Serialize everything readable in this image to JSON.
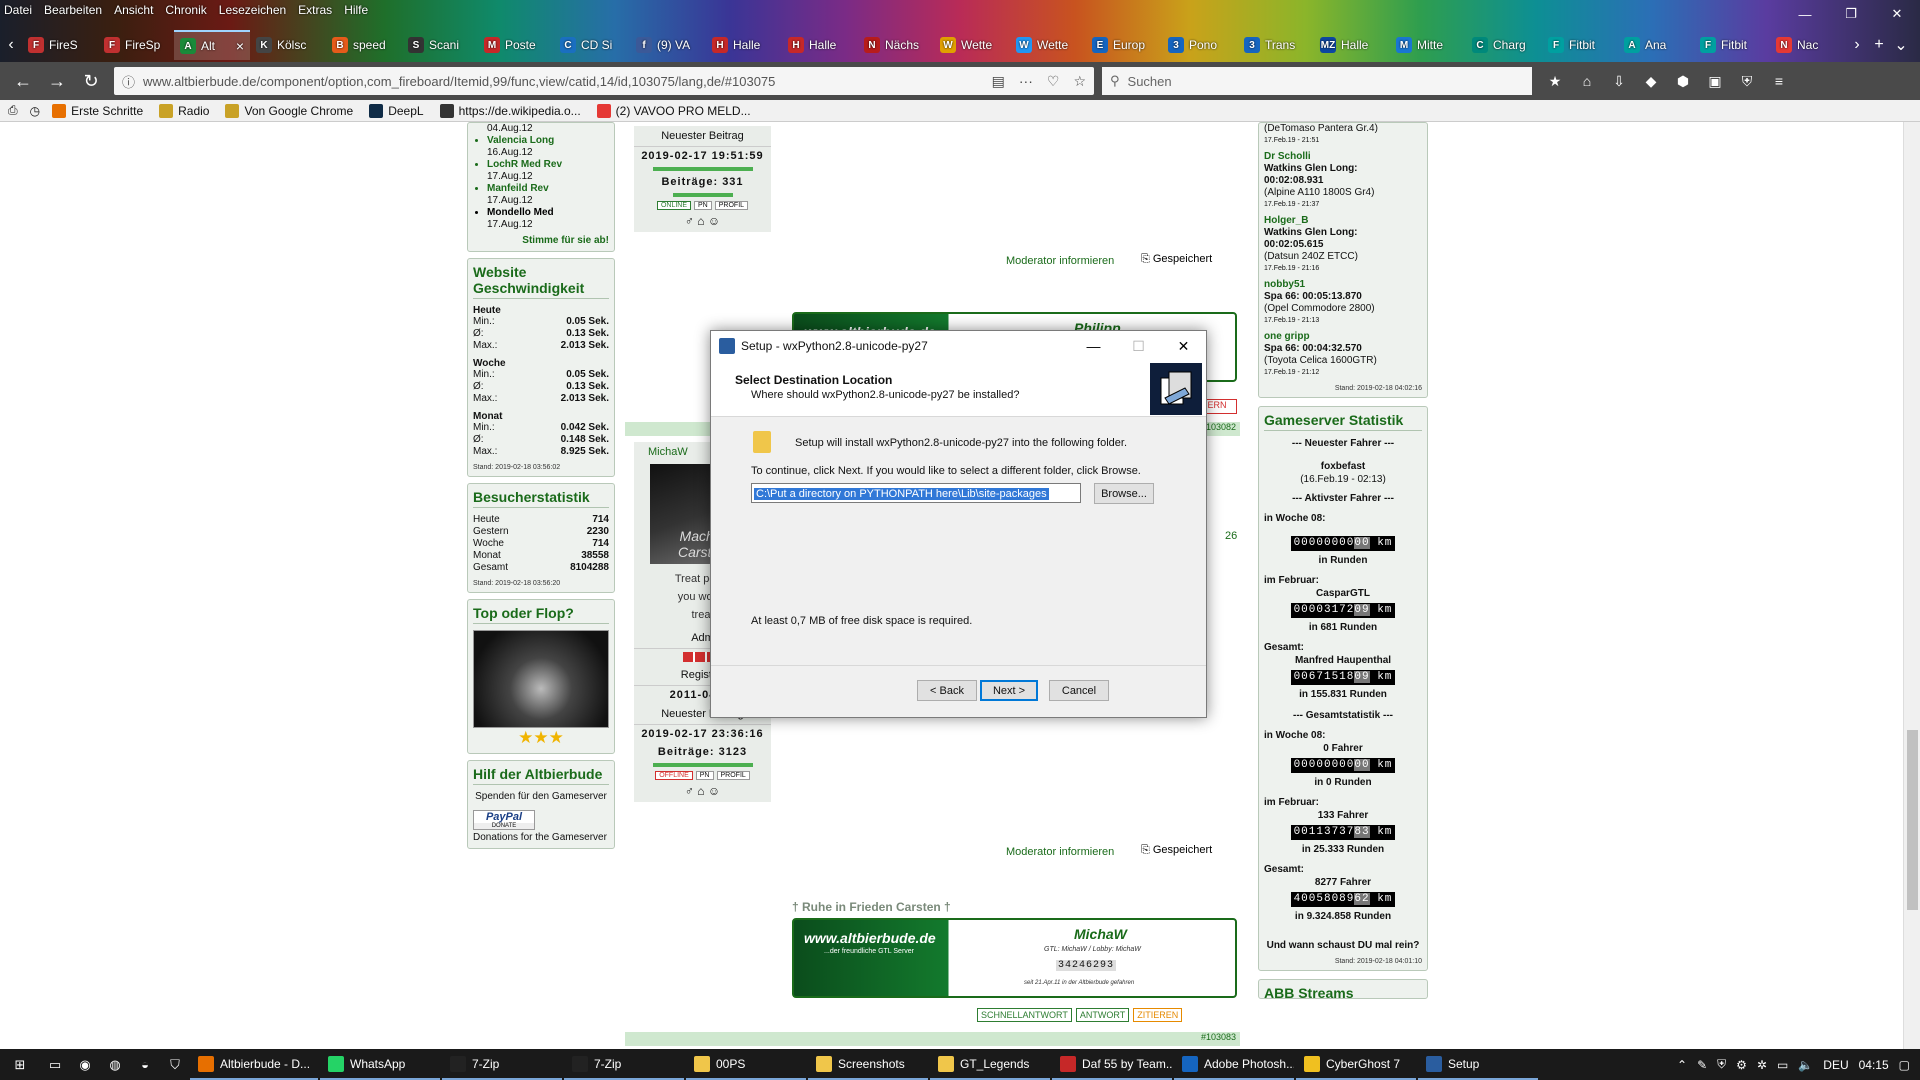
{
  "menu": [
    "Datei",
    "Bearbeiten",
    "Ansicht",
    "Chronik",
    "Lesezeichen",
    "Extras",
    "Hilfe"
  ],
  "tabs": [
    {
      "label": "FireS",
      "color": "#c03030",
      "glyph": "F"
    },
    {
      "label": "FireSp",
      "color": "#c03030",
      "glyph": "F"
    },
    {
      "label": "Alt",
      "color": "#1a8a3a",
      "glyph": "A",
      "active": true
    },
    {
      "label": "Kölsc",
      "color": "#444",
      "glyph": "K"
    },
    {
      "label": "speed",
      "color": "#e65b1a",
      "glyph": "B"
    },
    {
      "label": "Scani",
      "color": "#333",
      "glyph": "S"
    },
    {
      "label": "Poste",
      "color": "#c62828",
      "glyph": "M"
    },
    {
      "label": "CD Si",
      "color": "#1a6fc0",
      "glyph": "C"
    },
    {
      "label": "(9) VA",
      "color": "#3b5998",
      "glyph": "f"
    },
    {
      "label": "Halle",
      "color": "#c62828",
      "glyph": "H"
    },
    {
      "label": "Halle",
      "color": "#c62828",
      "glyph": "H"
    },
    {
      "label": "Nächs",
      "color": "#b71c1c",
      "glyph": "N"
    },
    {
      "label": "Wette",
      "color": "#e0a000",
      "glyph": "W"
    },
    {
      "label": "Wette",
      "color": "#2196f3",
      "glyph": "W"
    },
    {
      "label": "Europ",
      "color": "#1565c0",
      "glyph": "E"
    },
    {
      "label": "Pono",
      "color": "#1565c0",
      "glyph": "3"
    },
    {
      "label": "Trans",
      "color": "#1565c0",
      "glyph": "3"
    },
    {
      "label": "Halle",
      "color": "#0d47a1",
      "glyph": "MZ"
    },
    {
      "label": "Mitte",
      "color": "#1976d2",
      "glyph": "M"
    },
    {
      "label": "Charg",
      "color": "#00897b",
      "glyph": "C"
    },
    {
      "label": "Fitbit",
      "color": "#00a0a0",
      "glyph": "F"
    },
    {
      "label": "Ana",
      "color": "#00a0a0",
      "glyph": "A"
    },
    {
      "label": "Fitbit",
      "color": "#00a0a0",
      "glyph": "F"
    },
    {
      "label": "Nac",
      "color": "#e53935",
      "glyph": "N"
    }
  ],
  "url": "www.altbierbude.de/component/option,com_fireboard/Itemid,99/func,view/catid,14/id,103075/lang,de/#103075",
  "search_placeholder": "Suchen",
  "bookmarks": [
    {
      "label": "Erste Schritte",
      "color": "#e76f00"
    },
    {
      "label": "Radio",
      "color": "#c9a227"
    },
    {
      "label": "Von Google Chrome",
      "color": "#c9a227"
    },
    {
      "label": "DeepL",
      "color": "#0f2b46"
    },
    {
      "label": "https://de.wikipedia.o...",
      "color": "#333"
    },
    {
      "label": "(2) VAVOO PRO MELD...",
      "color": "#e53935"
    }
  ],
  "left": {
    "toplist": [
      {
        "track": "04.Aug.12",
        "date": ""
      },
      {
        "track": "Valencia Long",
        "date": "16.Aug.12"
      },
      {
        "track": "LochR Med Rev",
        "date": "17.Aug.12"
      },
      {
        "track": "Manfeild Rev",
        "date": "17.Aug.12"
      },
      {
        "track": "Mondello Med",
        "date": "17.Aug.12"
      }
    ],
    "vote": "Stimme für sie ab!",
    "speed_title": "Website Geschwindigkeit",
    "speed": [
      {
        "title": "Heute",
        "rows": [
          [
            "Min.:",
            "0.05 Sek."
          ],
          [
            "Ø:",
            "0.13 Sek."
          ],
          [
            "Max.:",
            "2.013 Sek."
          ]
        ]
      },
      {
        "title": "Woche",
        "rows": [
          [
            "Min.:",
            "0.05 Sek."
          ],
          [
            "Ø:",
            "0.13 Sek."
          ],
          [
            "Max.:",
            "2.013 Sek."
          ]
        ]
      },
      {
        "title": "Monat",
        "rows": [
          [
            "Min.:",
            "0.042 Sek."
          ],
          [
            "Ø:",
            "0.148 Sek."
          ],
          [
            "Max.:",
            "8.925 Sek."
          ]
        ]
      }
    ],
    "speed_stand": "Stand: 2019-02-18 03:56:02",
    "visitor_title": "Besucherstatistik",
    "visitors": [
      [
        "Heute",
        "714"
      ],
      [
        "Gestern",
        "2230"
      ],
      [
        "Woche",
        "714"
      ],
      [
        "Monat",
        "38558"
      ],
      [
        "Gesamt",
        "8104288"
      ]
    ],
    "visitor_stand": "Stand: 2019-02-18 03:56:20",
    "topflop_title": "Top oder Flop?",
    "help_title": "Hilf der Altbierbude",
    "help_text": "Spenden für den Gameserver",
    "paypal": "PayPal",
    "donate": "DONATE",
    "donations": "Donations for the Gameserver"
  },
  "posts": {
    "p1": {
      "newest_label": "Neuester Beitrag",
      "newest": "2019-02-17 19:51:59",
      "count": "Beiträge: 331",
      "status": [
        "ONLINE",
        "PN",
        "PROFIL"
      ],
      "mod": "Moderator informieren",
      "saved": "Gespeichert",
      "sig_site": "www.altbierbude.de",
      "sig_name": "Philipp"
    },
    "p2": {
      "author": "MichaW",
      "partial1": "Treat peopl",
      "partial2": "you would",
      "partial3": "treat",
      "adm": "Adm",
      "reg_label": "Registrie",
      "reg": "2011-04-03",
      "newest_label": "Neuester Beitrag",
      "newest": "2019-02-17 23:36:16",
      "count": "Beiträge: 3123",
      "status": [
        "OFFLINE",
        "PN",
        "PROFIL"
      ],
      "mod": "Moderator informieren",
      "saved": "Gespeichert",
      "rip": "† Ruhe in Frieden Carsten †",
      "sig_site": "www.altbierbude.de",
      "sig_sub": "...der freundliche GTL Server",
      "sig_name": "MichaW",
      "sig_gtl": "GTL: MichaW / Lobby: MichaW",
      "sig_odo": "34246293",
      "sig_since": "seit 21.Apr.11 in der Altbierbude gefahren",
      "actions": [
        "SCHNELLANTWORT",
        "ANTWORT",
        "ZITIEREN"
      ],
      "id1": "103082",
      "id2": "#103083",
      "side": "26",
      "partial_img": "Mach e Carsten"
    }
  },
  "right": {
    "laps": [
      {
        "user": "",
        "track": "",
        "time": "(DeTomaso Pantera Gr.4)",
        "date": "17.Feb.19 - 21:51"
      },
      {
        "user": "Dr Scholli",
        "track": "Watkins Glen Long:",
        "time": "00:02:08.931",
        "car": "(Alpine A110 1800S Gr4)",
        "date": "17.Feb.19 - 21:37"
      },
      {
        "user": "Holger_B",
        "track": "Watkins Glen Long:",
        "time": "00:02:05.615",
        "car": "(Datsun 240Z ETCC)",
        "date": "17.Feb.19 - 21:16"
      },
      {
        "user": "nobby51",
        "track": "Spa 66: 00:05:13.870",
        "time": "",
        "car": "(Opel Commodore 2800)",
        "date": "17.Feb.19 - 21:13"
      },
      {
        "user": "one gripp",
        "track": "Spa 66: 00:04:32.570",
        "time": "",
        "car": "(Toyota Celica 1600GTR)",
        "date": "17.Feb.19 - 21:12"
      }
    ],
    "laps_stand": "Stand: 2019-02-18 04:02:16",
    "gs_title": "Gameserver Statistik",
    "newest_driver_h": "--- Neuester Fahrer ---",
    "newest_driver": "foxbefast",
    "newest_driver_date": "(16.Feb.19 - 02:13)",
    "active_h": "--- Aktivster Fahrer ---",
    "week_label": "in Woche 08:",
    "week_odo": "00000000",
    "week_dec": "00",
    "week_runs": "in Runden",
    "feb_label": "im Februar:",
    "feb_driver": "CasparGTL",
    "feb_odo": "00003172",
    "feb_dec": "09",
    "feb_runs": "in 681 Runden",
    "total_label": "Gesamt:",
    "total_driver": "Manfred Haupenthal",
    "total_odo": "00671518",
    "total_dec": "09",
    "total_runs": "in 155.831 Runden",
    "gstat_h": "--- Gesamtstatistik ---",
    "gw_label": "in Woche 08:",
    "gw_drivers": "0 Fahrer",
    "gw_odo": "00000000",
    "gw_dec": "00",
    "gw_runs": "in 0 Runden",
    "gf_label": "im Februar:",
    "gf_drivers": "133 Fahrer",
    "gf_odo": "00113737",
    "gf_dec": "83",
    "gf_runs": "in 25.333 Runden",
    "gt_label": "Gesamt:",
    "gt_drivers": "8277 Fahrer",
    "gt_odo": "40058089",
    "gt_dec": "62",
    "gt_runs": "in 9.324.858 Runden",
    "km": "km",
    "question": "Und wann schaust DU mal rein?",
    "gs_stand": "Stand: 2019-02-18 04:01:10",
    "next_title": "ABB Streams"
  },
  "dialog": {
    "title": "Setup - wxPython2.8-unicode-py27",
    "heading": "Select Destination Location",
    "subheading": "Where should wxPython2.8-unicode-py27 be installed?",
    "line1": "Setup will install wxPython2.8-unicode-py27 into the following folder.",
    "line2": "To continue, click Next. If you would like to select a different folder, click Browse.",
    "path": "C:\\Put a directory on PYTHONPATH here\\Lib\\site-packages",
    "browse": "Browse...",
    "space": "At least 0,7 MB of free disk space is required.",
    "back": "< Back",
    "next": "Next >",
    "cancel": "Cancel"
  },
  "taskbar": {
    "items": [
      {
        "label": "Altbierbude - D...",
        "color": "#e76f00"
      },
      {
        "label": "WhatsApp",
        "color": "#25d366"
      },
      {
        "label": "7-Zip",
        "color": "#222"
      },
      {
        "label": "7-Zip",
        "color": "#222"
      },
      {
        "label": "00PS",
        "color": "#f0c64a"
      },
      {
        "label": "Screenshots",
        "color": "#f0c64a"
      },
      {
        "label": "GT_Legends",
        "color": "#f0c64a"
      },
      {
        "label": "Daf 55 by Team...",
        "color": "#c62828"
      },
      {
        "label": "Adobe Photosh...",
        "color": "#1565c0"
      },
      {
        "label": "CyberGhost 7",
        "color": "#f0c020"
      },
      {
        "label": "Setup",
        "color": "#2a5d9f"
      }
    ],
    "lang": "DEU",
    "time": "04:15"
  }
}
